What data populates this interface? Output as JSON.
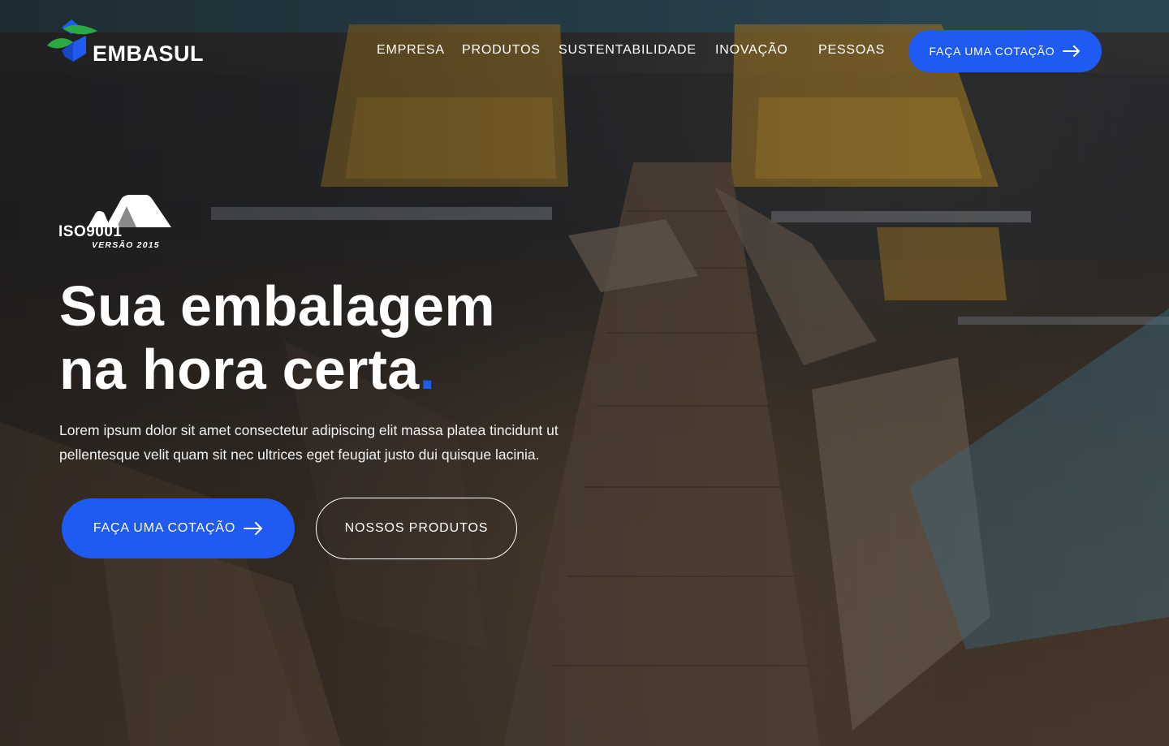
{
  "brand": {
    "name": "EMBASUL",
    "colors": {
      "accent": "#1f5bf2",
      "logo_green": "#2ca845",
      "logo_blue": "#1f5bf2"
    },
    "logo_icon": "embasul-leaf-cube-icon"
  },
  "nav": {
    "items": [
      {
        "label": "EMPRESA"
      },
      {
        "label": "PRODUTOS"
      },
      {
        "label": "SUSTENTABILIDADE"
      },
      {
        "label": "INOVAÇÃO"
      },
      {
        "label": "PESSOAS"
      }
    ],
    "cta_label": "FAÇA UMA COTAÇÃO",
    "cta_icon": "arrow-right-icon"
  },
  "hero": {
    "certification": {
      "label": "ISO9001",
      "sub_label": "VERSÃO 2015",
      "icon": "iso-certification-icon"
    },
    "headline_line1": "Sua embalagem",
    "headline_line2": "na hora certa",
    "headline_dot": ".",
    "description": "Lorem ipsum dolor sit amet consectetur adipiscing elit massa platea tincidunt ut pellentesque velit quam sit nec ultrices eget feugiat justo dui quisque lacinia.",
    "primary_cta_label": "FAÇA UMA COTAÇÃO",
    "primary_cta_icon": "arrow-right-icon",
    "secondary_cta_label": "NOSSOS PRODUTOS",
    "background_image": "cardboard-conveyor-photo"
  }
}
